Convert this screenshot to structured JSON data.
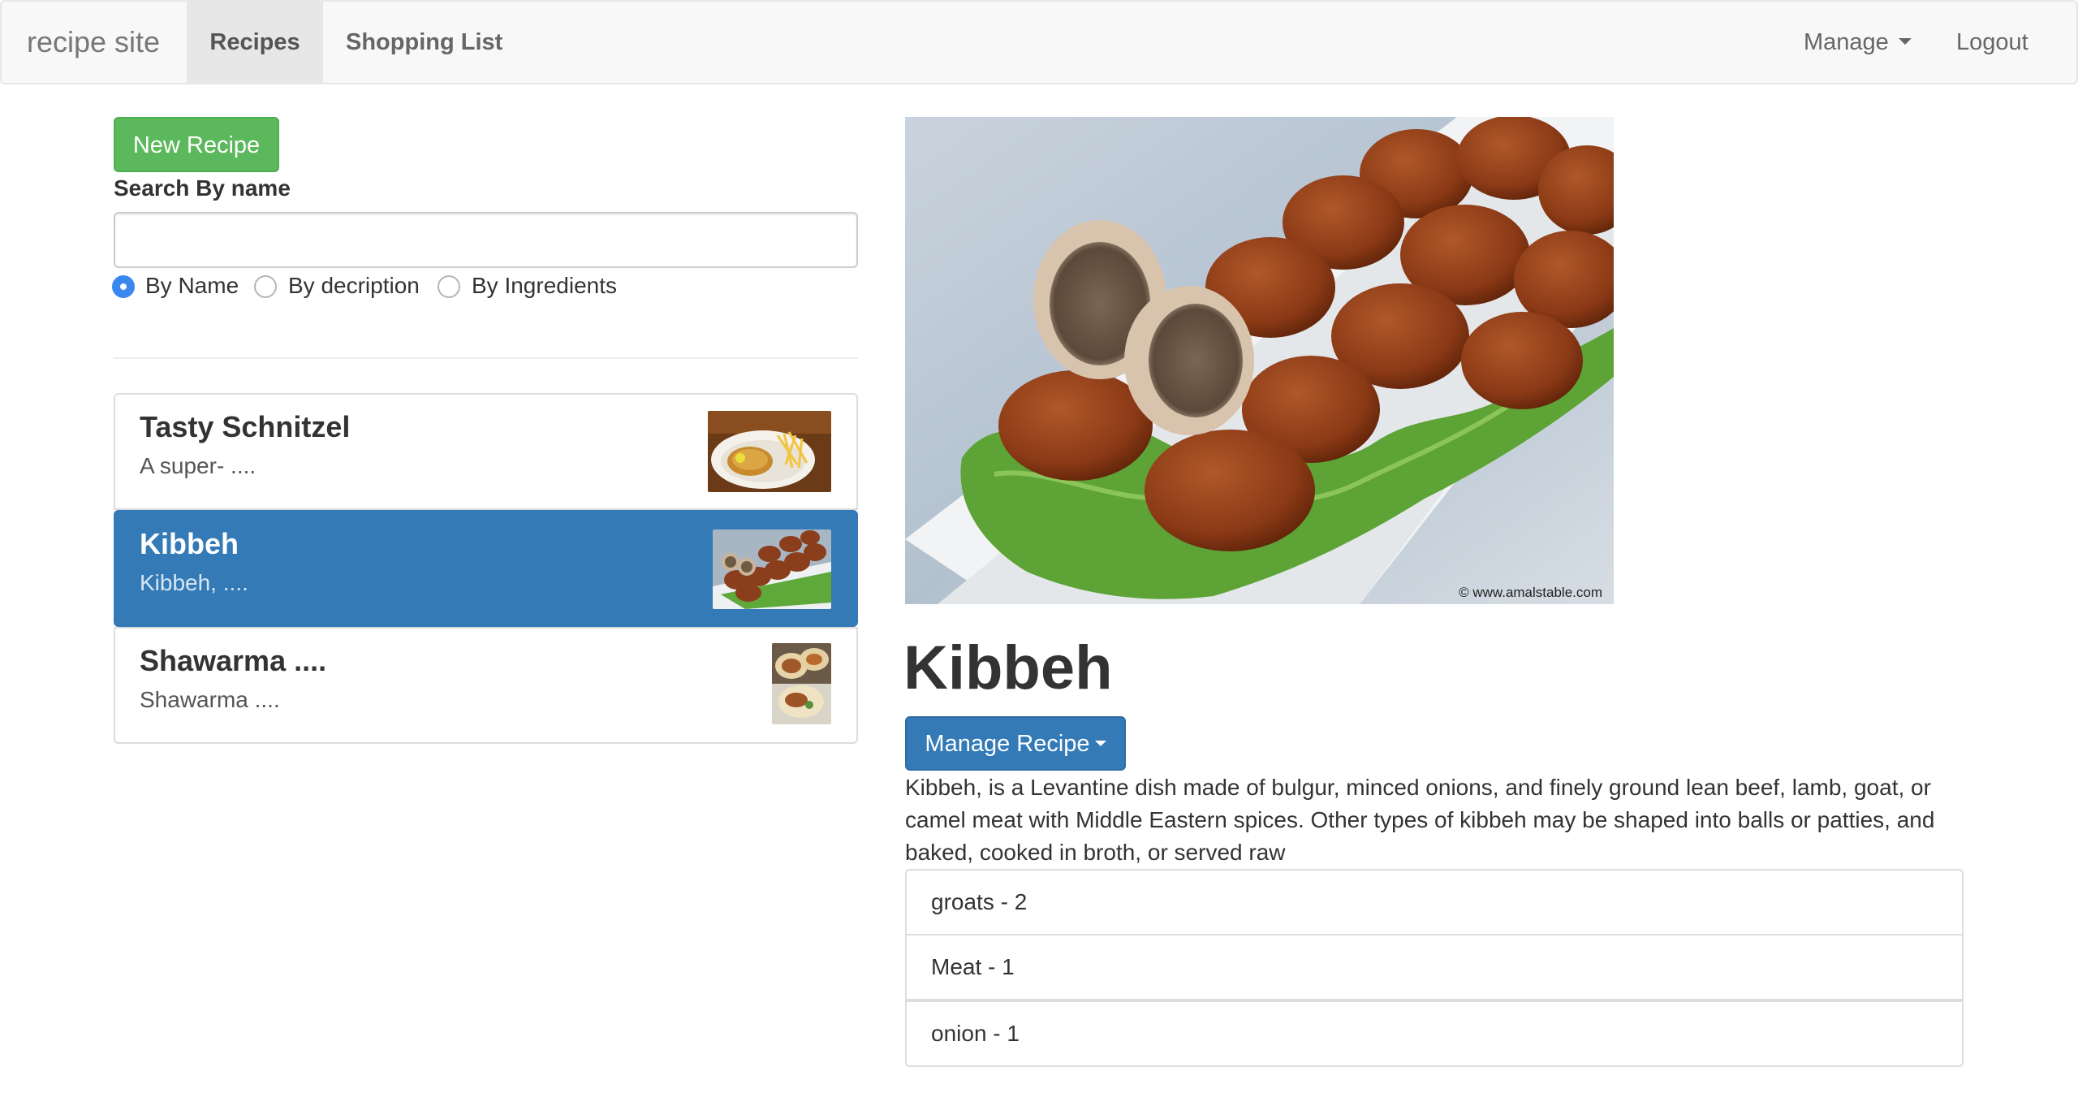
{
  "navbar": {
    "brand": "recipe site",
    "links": [
      {
        "label": "Recipes",
        "active": true
      },
      {
        "label": "Shopping List",
        "active": false
      }
    ],
    "manage_label": "Manage",
    "logout_label": "Logout"
  },
  "sidebar": {
    "new_recipe_label": "New Recipe",
    "search_label": "Search By name",
    "search_value": "",
    "search_options": [
      {
        "label": "By Name",
        "checked": true
      },
      {
        "label": "By decription",
        "checked": false
      },
      {
        "label": "By Ingredients",
        "checked": false
      }
    ],
    "recipes": [
      {
        "name": "Tasty Schnitzel",
        "description": "A super- ....",
        "selected": false
      },
      {
        "name": "Kibbeh",
        "description": "Kibbeh, ....",
        "selected": true
      },
      {
        "name": "Shawarma ....",
        "description": "Shawarma ....",
        "selected": false
      }
    ]
  },
  "detail": {
    "image_watermark": "© www.amalstable.com",
    "title": "Kibbeh",
    "manage_label": "Manage Recipe",
    "description": "Kibbeh, is a Levantine dish made of bulgur, minced onions, and finely ground lean beef, lamb, goat, or camel meat with Middle Eastern spices. Other types of kibbeh may be shaped into balls or patties, and baked, cooked in broth, or served raw",
    "ingredients": [
      "groats - 2",
      "Meat - 1",
      "onion - 1"
    ]
  },
  "colors": {
    "success": "#5cb85c",
    "primary": "#337ab7",
    "radio_checked": "#3b87f0"
  }
}
